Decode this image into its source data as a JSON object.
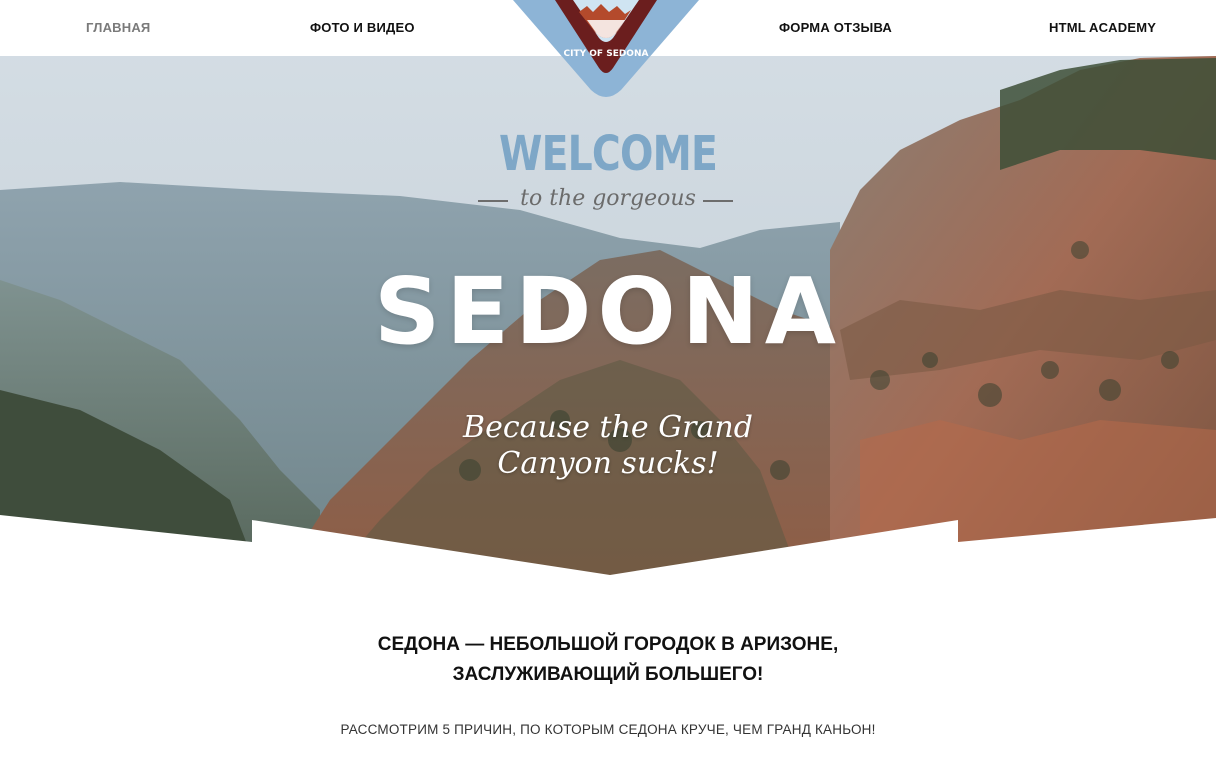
{
  "nav": {
    "items": [
      {
        "label": "ГЛАВНАЯ",
        "active": true
      },
      {
        "label": "ФОТО И ВИДЕО",
        "active": false
      },
      {
        "label": "ФОРМА ОТЗЫВА",
        "active": false
      },
      {
        "label": "HTML ACADEMY",
        "active": false
      }
    ]
  },
  "logo": {
    "text": "CITY OF SEDONA",
    "icon": "city-of-sedona-seal"
  },
  "hero": {
    "welcome": "WELCOME",
    "gorgeous": "to the gorgeous",
    "title": "SEDONA",
    "slogan_line1": "Because the Grand",
    "slogan_line2": "Canyon sucks!"
  },
  "intro": {
    "title_line1": "СЕДОНА — НЕБОЛЬШОЙ ГОРОДОК В АРИЗОНЕ,",
    "title_line2": "ЗАСЛУЖИВАЮЩИЙ БОЛЬШЕГО!",
    "subtitle": "РАССМОТРИМ 5 ПРИЧИН, ПО КОТОРЫМ СЕДОНА КРУЧЕ, ЧЕМ ГРАНД КАНЬОН!"
  },
  "colors": {
    "accent_blue": "#7ea7c7",
    "seal_red": "#6b1e1e",
    "text_dark": "#111111",
    "nav_active": "#7a7a7a"
  }
}
